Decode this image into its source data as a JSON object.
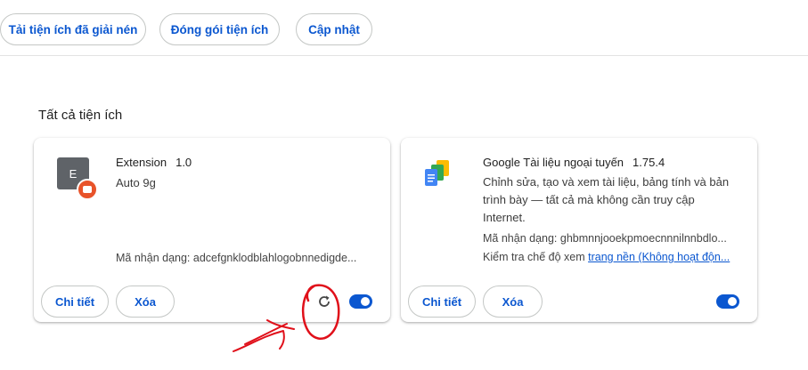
{
  "toolbar": {
    "load_unpacked": "Tải tiện ích đã giải nén",
    "pack_extension": "Đóng gói tiện ích",
    "update": "Cập nhật"
  },
  "section_title": "Tất cả tiện ích",
  "extensions": [
    {
      "name": "Extension",
      "version": "1.0",
      "icon_letter": "E",
      "description": "Auto 9g",
      "id_text": "Mã nhận dạng: adcefgnklodblahlogobnnedigde...",
      "details_label": "Chi tiết",
      "remove_label": "Xóa",
      "enabled": true
    },
    {
      "name": "Google Tài liệu ngoại tuyến",
      "version": "1.75.4",
      "description": "Chỉnh sửa, tạo và xem tài liệu, bảng tính và bản trình bày — tất cả mà không cần truy cập Internet.",
      "id_text": "Mã nhận dạng: ghbmnnjooekpmoecnnnilnnbdlo...",
      "inspect_prefix": "Kiểm tra chế độ xem ",
      "inspect_link": "trang nền (Không hoạt độn...",
      "details_label": "Chi tiết",
      "remove_label": "Xóa",
      "enabled": true
    }
  ],
  "colors": {
    "accent": "#0b57d0",
    "annotation": "#e0101a",
    "badge": "#e8532a"
  }
}
